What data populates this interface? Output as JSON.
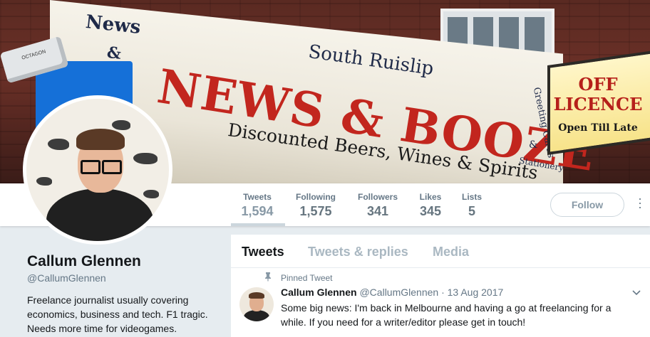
{
  "banner": {
    "sign_news": "News",
    "sign_amp": "&",
    "sign_location": "South Ruislip",
    "sign_title": "NEWS & BOOZE",
    "sign_sub": "Discounted Beers, Wines & Spirits",
    "sign_greeting": "Greeting Cards",
    "sign_amp2": "&",
    "sign_stationery": "Stationery",
    "off_licence_1": "OFF",
    "off_licence_2": "LICENCE",
    "off_licence_3": "Open Till Late",
    "cctv_label": "OCTAGON"
  },
  "stats": [
    {
      "label": "Tweets",
      "value": "1,594"
    },
    {
      "label": "Following",
      "value": "1,575"
    },
    {
      "label": "Followers",
      "value": "341"
    },
    {
      "label": "Likes",
      "value": "345"
    },
    {
      "label": "Lists",
      "value": "5"
    }
  ],
  "follow_label": "Follow",
  "profile": {
    "name": "Callum Glennen",
    "handle": "@CallumGlennen",
    "bio": "Freelance journalist usually covering economics, business and tech. F1 tragic. Needs more time for videogames."
  },
  "tabs": [
    {
      "label": "Tweets"
    },
    {
      "label": "Tweets & replies"
    },
    {
      "label": "Media"
    }
  ],
  "tweet": {
    "pinned_label": "Pinned Tweet",
    "name": "Callum Glennen",
    "handle": "@CallumGlennen",
    "dot": "·",
    "date": "13 Aug 2017",
    "text": "Some big news: I'm back in Melbourne and having a go at freelancing for a while. If you need for a writer/editor please get in touch!"
  },
  "colors": {
    "accent": "#1da1f2",
    "bg": "#e6ecf0",
    "muted": "#657786"
  }
}
